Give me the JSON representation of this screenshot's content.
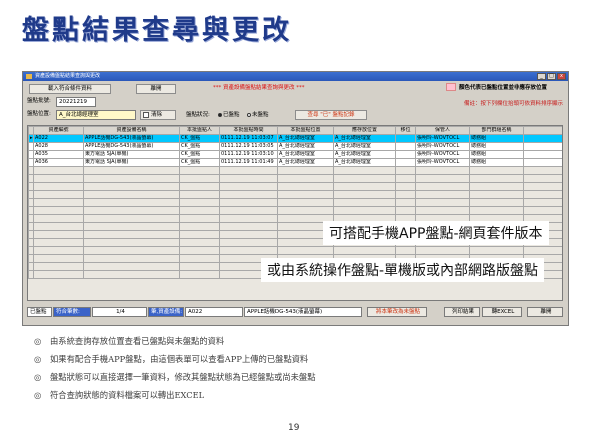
{
  "slide": {
    "title": "盤點結果查尋與更改",
    "overlay_text_1": "可搭配手機APP盤點-網頁套件版本",
    "overlay_text_2": "或由系統操作盤點-單機版或內部網路版盤點",
    "bullet_marker": "◎",
    "bullets": [
      "由系統查詢存放位置查看已盤點與未盤點的資料",
      "如果有配合手機APP盤點，由這個表單可以查看APP上傳的已盤點資料",
      "盤點狀態可以直接選擇一筆資料，修改其盤點狀態為已經盤點或尚未盤點",
      "符合查詢狀態的資料檔案可以轉出EXCEL"
    ],
    "page_number": "19"
  },
  "window": {
    "title": "資產設備盤點結果查詢與更改",
    "banner": "***   資產設備盤點結果查詢與更改   ***",
    "color_legend": "顏色代表已盤點位置並非應存放位置",
    "hint": "備註：按下列欄位抬頭可依資料排序顯示",
    "import_button": "載入符合條件資料",
    "close_top_button": "離開",
    "batch_label": "盤點批號:",
    "batch_value": "20221219",
    "location_label": "盤點位置:",
    "location_value": "A_台北總經理室",
    "clear_button": "清除",
    "status_label": "盤點狀況:",
    "radio_done": "已盤點",
    "radio_not_done": "未盤點",
    "query_button": "查尋 \"已\" 盤點記錄"
  },
  "table": {
    "columns": [
      "資產編號",
      "資產設備名稱",
      "本批盤點人",
      "本批盤點時間",
      "本批盤點位置",
      "應存放位置",
      "移位",
      "保管人",
      "部門群組名稱"
    ],
    "rows": [
      [
        "A022",
        "APPLE話機DG-543(液晶螢幕)",
        "CK_盤點",
        "0111.12.19 11:03:07",
        "A_台北總經理室",
        "A_台北總經理室",
        "",
        "張明玲-WOVTOCL",
        "總務組"
      ],
      [
        "A028",
        "APPLE話機DG-543(液晶螢幕)",
        "CK_盤點",
        "0111.12.19 11:03:05",
        "A_台北總經理室",
        "A_台北總經理室",
        "",
        "張明玲-WOVTOCL",
        "總務組"
      ],
      [
        "A035",
        "東方電話 SJA(單機)",
        "CK_盤點",
        "0111.12.19 11:03:10",
        "A_台北總經理室",
        "A_台北總經理室",
        "",
        "張明玲-WOVTOCL",
        "總務組"
      ],
      [
        "A036",
        "東方電話 SJA(單機)",
        "CK_盤點",
        "0111.12.19 11:01:49",
        "A_台北總經理室",
        "A_台北總經理室",
        "",
        "張明玲-WOVTOCL",
        "總務組"
      ]
    ]
  },
  "statusbar": {
    "done_label": "已盤點",
    "count_label": "符合筆數:",
    "count_value": "1/4",
    "current_label": "筆,資產設備:",
    "current_id": "A022",
    "current_name": "APPLE話機DG-543(液晶螢幕)",
    "mark_button": "將本筆改為未盤點",
    "print_button": "列印結果",
    "excel_button": "轉EXCEL",
    "close_button": "離開"
  },
  "colors": {
    "selected_row": "#00c8ff",
    "title_blue": "#1f3a8a",
    "legend_pink": "#ffc0d0",
    "warn_red": "#d11111"
  }
}
